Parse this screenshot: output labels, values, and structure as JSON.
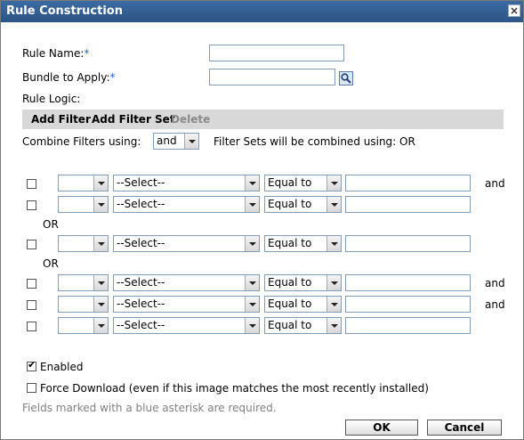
{
  "dialog": {
    "title": "Rule Construction",
    "close_glyph": "×"
  },
  "form": {
    "rule_name_label": "Rule Name:",
    "rule_name_required": "*",
    "rule_name_value": "",
    "bundle_label": "Bundle to Apply:",
    "bundle_required": "*",
    "bundle_value": "",
    "rule_logic_label": "Rule Logic:"
  },
  "toolbar": {
    "add_filter": "Add Filter",
    "add_filter_set": "Add Filter Set",
    "delete": "Delete"
  },
  "combine": {
    "label": "Combine Filters using:",
    "value": "and",
    "sets_label": "Filter Sets will be combined using: OR"
  },
  "filter_sets": [
    {
      "rows": [
        {
          "checked": false,
          "first": "",
          "field": "--Select--",
          "operator": "Equal to",
          "value": "",
          "conj": "and"
        },
        {
          "checked": false,
          "first": "",
          "field": "--Select--",
          "operator": "Equal to",
          "value": "",
          "conj": ""
        }
      ]
    },
    {
      "separator": "OR",
      "rows": [
        {
          "checked": false,
          "first": "",
          "field": "--Select--",
          "operator": "Equal to",
          "value": "",
          "conj": ""
        }
      ]
    },
    {
      "separator": "OR",
      "rows": [
        {
          "checked": false,
          "first": "",
          "field": "--Select--",
          "operator": "Equal to",
          "value": "",
          "conj": "and"
        },
        {
          "checked": false,
          "first": "",
          "field": "--Select--",
          "operator": "Equal to",
          "value": "",
          "conj": "and"
        },
        {
          "checked": false,
          "first": "",
          "field": "--Select--",
          "operator": "Equal to",
          "value": "",
          "conj": ""
        }
      ]
    }
  ],
  "options": {
    "enabled_label": "Enabled",
    "enabled_checked": true,
    "force_download_label": "Force Download (even if this image matches the most recently installed)",
    "force_download_checked": false
  },
  "hint": "Fields marked with a blue asterisk are required.",
  "buttons": {
    "ok": "OK",
    "cancel": "Cancel"
  },
  "icons": {
    "search": "search-icon",
    "close": "close-icon",
    "dropdown": "chevron-down-icon"
  },
  "colors": {
    "titlebar": "#2d5586",
    "required_asterisk": "#1e64d4",
    "toolbar_bg": "#d8d8d8"
  }
}
